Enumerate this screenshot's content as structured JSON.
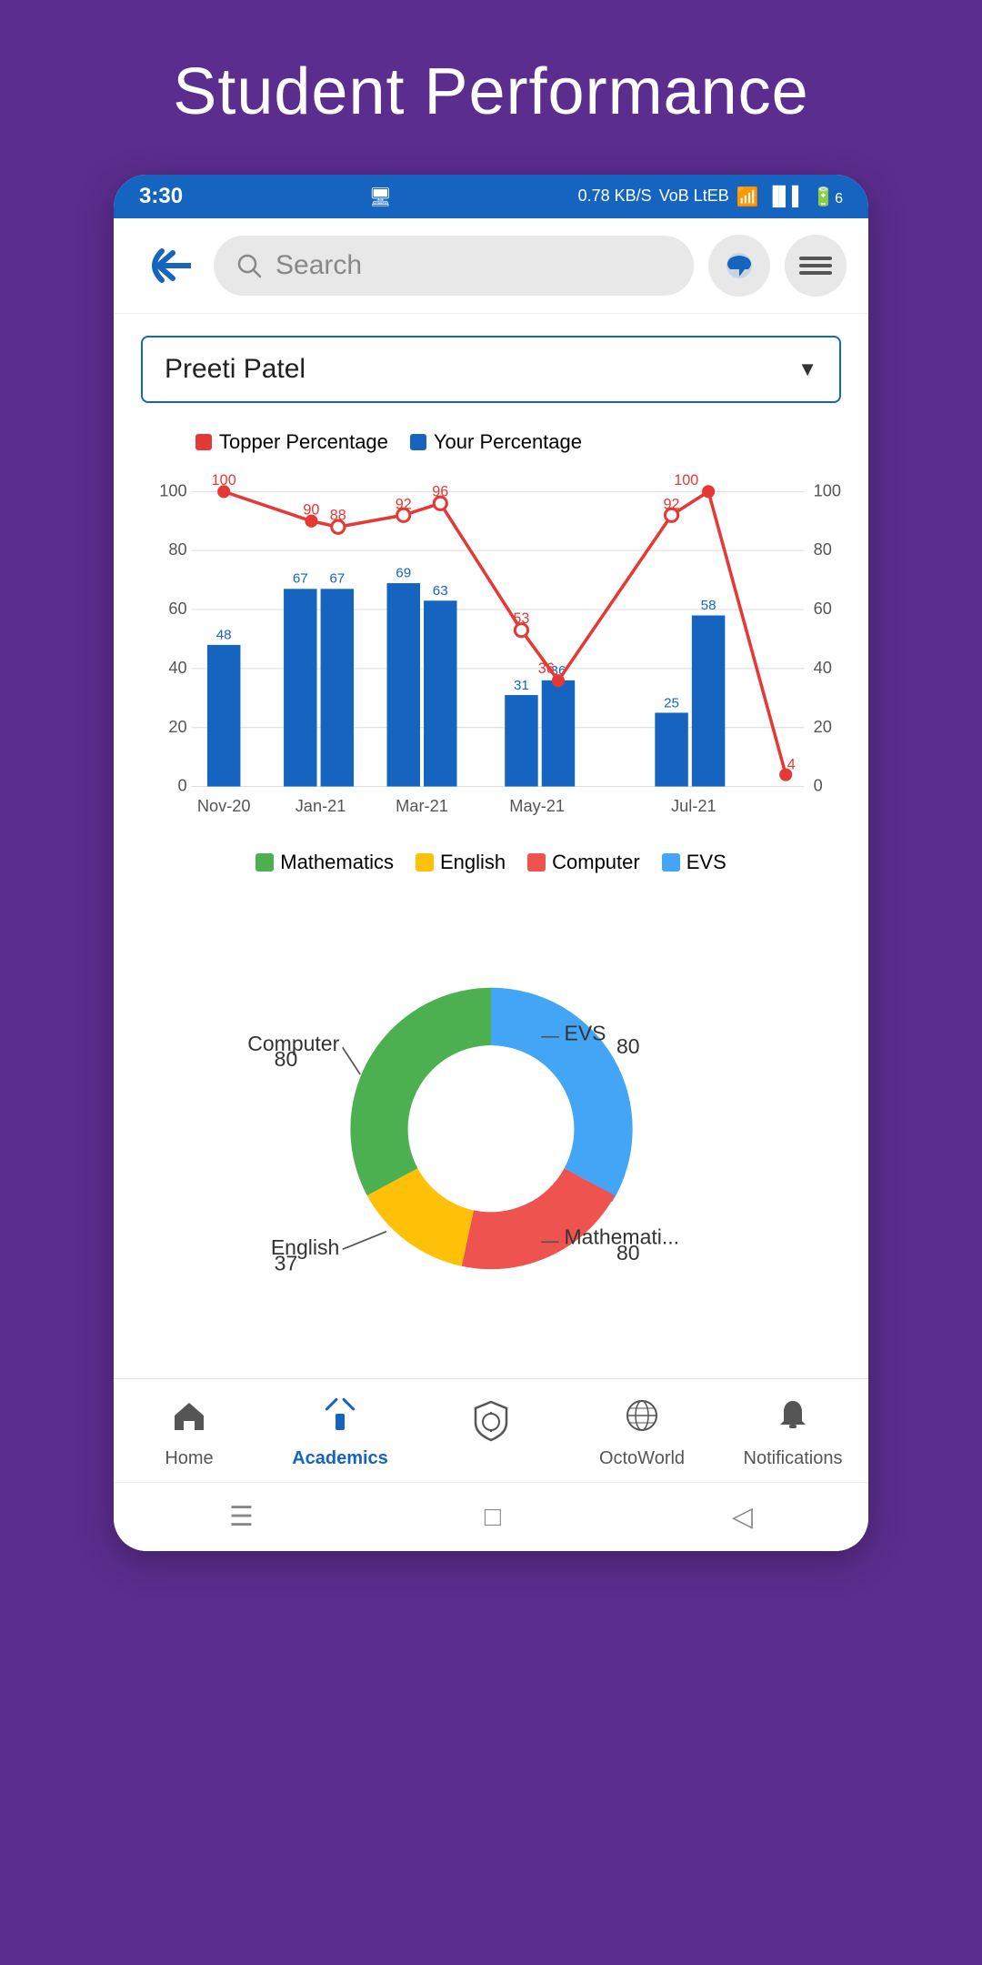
{
  "page": {
    "title": "Student Performance",
    "background_color": "#5b2d8e"
  },
  "status_bar": {
    "time": "3:30",
    "network_speed": "0.78 KB/S",
    "network_type": "VoB LtEB",
    "signal": "4G",
    "battery": "6"
  },
  "nav_bar": {
    "search_placeholder": "Search",
    "back_label": "back"
  },
  "student_dropdown": {
    "selected": "Preeti Patel",
    "options": [
      "Preeti Patel"
    ]
  },
  "chart": {
    "legend": {
      "topper": "Topper Percentage",
      "yours": "Your Percentage"
    },
    "months": [
      "Nov-20",
      "Jan-21",
      "Mar-21",
      "May-21",
      "Jul-21"
    ],
    "bars": [
      {
        "month": "Nov-20",
        "value": 48
      },
      {
        "month": "Jan-21",
        "value": 67
      },
      {
        "month": "Jan-21b",
        "value": 67
      },
      {
        "month": "Mar-21a",
        "value": 69
      },
      {
        "month": "Mar-21b",
        "value": 63
      },
      {
        "month": "May-21a",
        "value": 31
      },
      {
        "month": "May-21b",
        "value": 36
      },
      {
        "month": "Jul-21a",
        "value": 25
      },
      {
        "month": "Jul-21b",
        "value": 58
      }
    ],
    "topper_line": [
      100,
      90,
      88,
      92,
      96,
      53,
      36,
      92,
      100,
      4
    ],
    "y_axis_labels": [
      0,
      20,
      40,
      60,
      80,
      100
    ],
    "subject_legend": [
      {
        "name": "Mathematics",
        "color": "#4caf50"
      },
      {
        "name": "English",
        "color": "#ffc107"
      },
      {
        "name": "Computer",
        "color": "#ef5350"
      },
      {
        "name": "EVS",
        "color": "#42a5f5"
      }
    ]
  },
  "donut_chart": {
    "segments": [
      {
        "name": "EVS",
        "value": 80,
        "color": "#42a5f5"
      },
      {
        "name": "Computer",
        "value": 80,
        "color": "#ef5350"
      },
      {
        "name": "English",
        "value": 37,
        "color": "#ffc107"
      },
      {
        "name": "Mathematics",
        "value": 80,
        "color": "#4caf50"
      }
    ]
  },
  "bottom_nav": {
    "items": [
      {
        "label": "Home",
        "icon": "🏠",
        "active": false
      },
      {
        "label": "Academics",
        "icon": "✏",
        "active": true
      },
      {
        "label": "",
        "icon": "🛡",
        "active": false,
        "center": true
      },
      {
        "label": "OctoWorld",
        "icon": "🌐",
        "active": false
      },
      {
        "label": "Notifications",
        "icon": "🔔",
        "active": false
      }
    ]
  },
  "android_nav": {
    "menu_icon": "☰",
    "home_icon": "□",
    "back_icon": "◁"
  }
}
